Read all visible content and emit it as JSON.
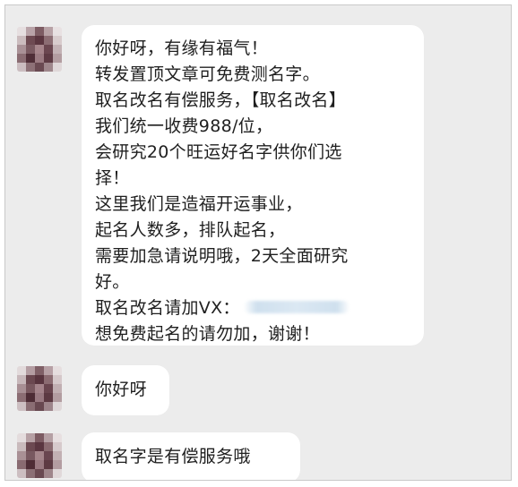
{
  "chat": {
    "messages": [
      {
        "lines": [
          "你好呀，有缘有福气！",
          "转发置顶文章可免费测名字。",
          "取名改名有偿服务，【取名改名】",
          "我们统一收费988/位，",
          "会研究20个旺运好名字供你们选",
          "择！",
          "这里我们是造福开运事业，",
          "起名人数多，排队起名，",
          "需要加急请说明哦，2天全面研究",
          "好。",
          "取名改名请加VX：",
          "想免费起名的请勿加，谢谢！"
        ]
      },
      {
        "lines": [
          "你好呀"
        ]
      },
      {
        "lines": [
          "取名字是有偿服务哦"
        ]
      }
    ]
  },
  "colors": {
    "chat_background": "#ececec",
    "bubble_background": "#ffffff",
    "text": "#1f1f1f"
  }
}
